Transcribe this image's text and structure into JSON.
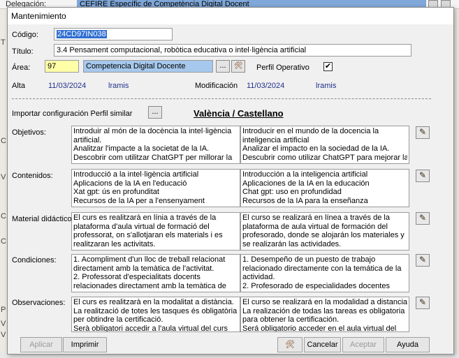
{
  "background": {
    "delegacion_label": "Delegación:",
    "delegacion_value": "CEFIRE Específic de Competència Digital Docent",
    "side_letters": [
      "T",
      "C",
      "V",
      "C",
      "C",
      "P",
      "V",
      "V"
    ]
  },
  "dialog": {
    "title": "Mantenimiento",
    "close_glyph": "✕",
    "codigo_label": "Código:",
    "codigo_value": "24CD97IN038",
    "titulo_label": "Título:",
    "titulo_value": "3.4 Pensament computacional, robòtica educativa o intel·ligència artificial",
    "area_label": "Área:",
    "area_code": "97",
    "area_name": "Competencia Digital Docente",
    "ellipsis": "...",
    "perfil_label": "Perfil Operativo",
    "perfil_checked": "✔",
    "alta_label": "Alta",
    "alta_date": "11/03/2024",
    "alta_user": "lramis",
    "mod_label": "Modificación",
    "mod_date": "11/03/2024",
    "mod_user": "lramis",
    "importar_label": "Importar configuración Perfil similar",
    "language_header": "València / Castellano",
    "sections": [
      {
        "label": "Objetivos:",
        "val": [
          "Introduir al món de la docència la intel·ligència",
          "artificial.",
          "Analitzar l'impacte a la societat de la IA.",
          "Descobrir com utilitzar ChatGPT per millorar la"
        ],
        "cas": [
          "Introducir en el mundo de la docencia la",
          "inteligencia artificial",
          "Analizar el impacto en la sociedad de la IA.",
          "Descubrir como utilizar ChatGPT para mejorar la"
        ]
      },
      {
        "label": "Contenidos:",
        "val": [
          "Introducció a la intel·ligència artificial",
          "Aplicacions de la IA en l'educació",
          "Xat gpt: ús en profunditat",
          "Recursos de la IA per a l'ensenyament"
        ],
        "cas": [
          "Introducción a la inteligencia artificial",
          "Aplicaciones de la IA en la educación",
          "Chat gpt: uso en profundidad",
          "Recursos de la IA para la enseñanza"
        ]
      },
      {
        "label": "Material didáctico:",
        "val": [
          "El curs es realitzarà en línia a través de la",
          "plataforma d'aula virtual de formació del",
          "professorat, on s'allotjaran els materials i es",
          "realitzaran les activitats."
        ],
        "cas": [
          "El curso se realizará en línea a través de la",
          "plataforma de aula virtual de formación del",
          "profesorado, donde se alojarán los materiales y",
          "se realizarán las actividades."
        ]
      },
      {
        "label": "Condiciones:",
        "val": [
          "1. Acompliment d'un lloc de treball relacionat",
          "directament amb la temàtica de l'activitat.",
          "2. Professorat d'especialitats docents",
          "relacionades directament amb la temàtica de"
        ],
        "cas": [
          "1. Desempeño de un puesto de trabajo",
          "relacionado directamente con la temática de la",
          "actividad.",
          "2. Profesorado de especialidades docentes"
        ]
      },
      {
        "label": "Observaciones:",
        "val": [
          "El curs es realitzarà en la modalitat a distància.",
          "La realització de totes les tasques és obligatòria",
          "per obtindre la certificació.",
          "Serà obligatori accedir a l'aula virtual del curs"
        ],
        "cas": [
          "El curso se realizará en la modalidad a distancia.",
          "La realización de todas las tareas es obligatoria",
          "para obtener la certificación.",
          "Será obligatorio acceder en el aula virtual del"
        ]
      }
    ],
    "buttons": {
      "aplicar": "Aplicar",
      "imprimir": "Imprimir",
      "cancelar": "Cancelar",
      "aceptar": "Aceptar",
      "ayuda": "Ayuda"
    }
  }
}
